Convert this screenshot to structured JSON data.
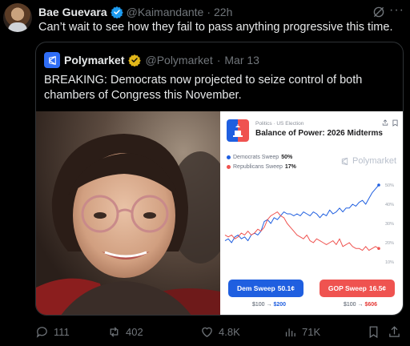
{
  "post": {
    "author_name": "Bae Guevara",
    "handle": "@Kaimandante",
    "separator": "·",
    "time": "22h",
    "text": "Can’t wait to see how they fail to pass anything progressive this time.",
    "icons": {
      "verified": "verified-badge-icon",
      "grok": "grok-icon",
      "more": "more-icon"
    },
    "colors": {
      "verified": "#1d9bf0",
      "muted": "#71767b"
    }
  },
  "quote": {
    "author_name": "Polymarket",
    "handle": "@Polymarket",
    "separator": "·",
    "time": "Mar 13",
    "text": "BREAKING: Democrats now projected to seize control of both chambers of Congress this November.",
    "colors": {
      "gold_check": "#e2b719",
      "logo": "#2f6df6"
    }
  },
  "card": {
    "category": "Politics · US Election",
    "title": "Balance of Power: 2026 Midterms",
    "watermark": "Polymarket",
    "legend": [
      {
        "name": "Democrats Sweep",
        "pct": "50%",
        "color": "#1f5fe0"
      },
      {
        "name": "Republicans Sweep",
        "pct": "17%",
        "color": "#ef5350"
      }
    ],
    "buttons": [
      {
        "label": "Dem Sweep",
        "price": "50.1¢",
        "payout_from": "$100",
        "arrow": "→",
        "payout_to": "$200",
        "color": "#1f5fe0"
      },
      {
        "label": "GOP Sweep",
        "price": "16.5¢",
        "payout_from": "$100",
        "arrow": "→",
        "payout_to": "$606",
        "color": "#ef5350"
      }
    ]
  },
  "chart_data": {
    "type": "line",
    "yticks": [
      "50%",
      "40%",
      "30%",
      "20%",
      "10%"
    ],
    "ylim": [
      10,
      50
    ],
    "series": [
      {
        "name": "Democrats Sweep",
        "color": "#1f5fe0",
        "values": [
          21,
          22,
          20,
          23,
          24,
          22,
          23,
          21,
          24,
          25,
          24,
          26,
          31,
          32,
          30,
          33,
          32,
          34,
          36,
          35,
          35,
          34,
          35,
          34,
          36,
          35,
          34,
          36,
          35,
          33,
          35,
          34,
          37,
          35,
          36,
          38,
          36,
          38,
          38,
          40,
          39,
          41,
          42,
          40,
          43,
          46,
          48,
          50
        ]
      },
      {
        "name": "Republicans Sweep",
        "color": "#ef5350",
        "values": [
          24,
          23,
          24,
          22,
          23,
          25,
          24,
          26,
          24,
          25,
          27,
          26,
          28,
          32,
          34,
          35,
          36,
          34,
          33,
          30,
          28,
          26,
          24,
          23,
          22,
          24,
          21,
          20,
          22,
          21,
          20,
          19,
          20,
          21,
          19,
          22,
          18,
          19,
          20,
          18,
          17,
          17,
          16,
          18,
          16,
          17,
          18,
          17
        ]
      }
    ],
    "grid": false,
    "legend": "top-left"
  },
  "actions": [
    {
      "name": "reply",
      "count": "111",
      "icon": "reply-icon"
    },
    {
      "name": "repost",
      "count": "402",
      "icon": "repost-icon"
    },
    {
      "name": "like",
      "count": "4.8K",
      "icon": "heart-icon"
    },
    {
      "name": "views",
      "count": "71K",
      "icon": "views-icon"
    },
    {
      "name": "bookmark",
      "count": "",
      "icon": "bookmark-icon"
    },
    {
      "name": "share",
      "count": "",
      "icon": "share-icon"
    }
  ]
}
